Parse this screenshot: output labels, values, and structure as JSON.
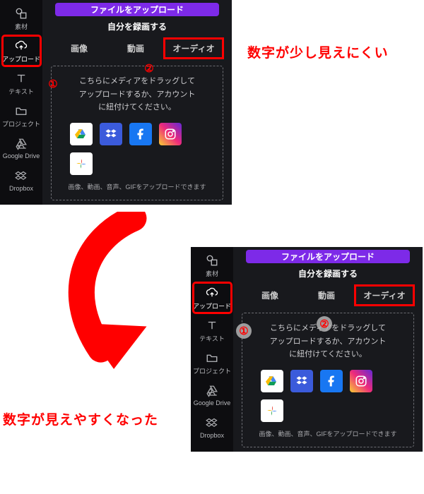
{
  "annotations": {
    "top": "数字が少し見えにくい",
    "bottom": "数字が見えやすくなった"
  },
  "markers": {
    "one": "①",
    "two": "②"
  },
  "sidebar": {
    "items": [
      {
        "label": "素材"
      },
      {
        "label": "アップロード"
      },
      {
        "label": "テキスト"
      },
      {
        "label": "プロジェクト"
      },
      {
        "label": "Google Drive"
      },
      {
        "label": "Dropbox"
      }
    ]
  },
  "main": {
    "upload_btn": "ファイルをアップロード",
    "record_btn": "自分を録画する",
    "tabs": {
      "image": "画像",
      "video": "動画",
      "audio": "オーディオ"
    },
    "drop_l1": "こちらにメディアをドラッグして",
    "drop_l2": "アップロードするか、アカウント",
    "drop_l3": "に紐付けてください。",
    "footnote": "画像、動画、音声、GIFをアップロードできます"
  },
  "apps": [
    "google-drive",
    "dropbox",
    "facebook",
    "instagram",
    "google-photos"
  ]
}
